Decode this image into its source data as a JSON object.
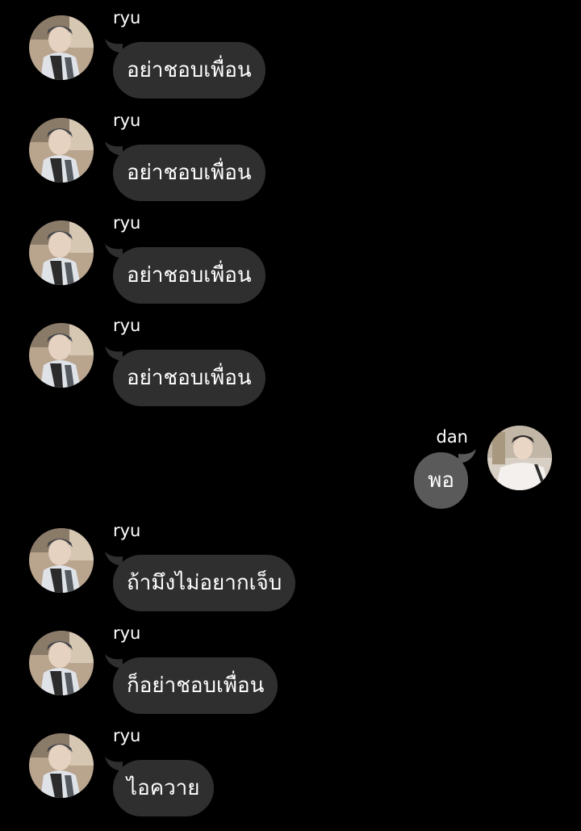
{
  "conversation": {
    "messages": [
      {
        "side": "left",
        "sender": "ryu",
        "text": "อย่าชอบเพื่อน"
      },
      {
        "side": "left",
        "sender": "ryu",
        "text": "อย่าชอบเพื่อน"
      },
      {
        "side": "left",
        "sender": "ryu",
        "text": "อย่าชอบเพื่อน"
      },
      {
        "side": "left",
        "sender": "ryu",
        "text": "อย่าชอบเพื่อน"
      },
      {
        "side": "right",
        "sender": "dan",
        "text": "พอ"
      },
      {
        "side": "left",
        "sender": "ryu",
        "text": "ถ้ามึงไม่อยากเจ็บ"
      },
      {
        "side": "left",
        "sender": "ryu",
        "text": "ก็อย่าชอบเพื่อน"
      },
      {
        "side": "left",
        "sender": "ryu",
        "text": "ไอควาย"
      }
    ]
  },
  "colors": {
    "background": "#000000",
    "incoming_bubble": "#2f2f2f",
    "outgoing_bubble": "#5a5a5a",
    "text": "#ffffff"
  }
}
